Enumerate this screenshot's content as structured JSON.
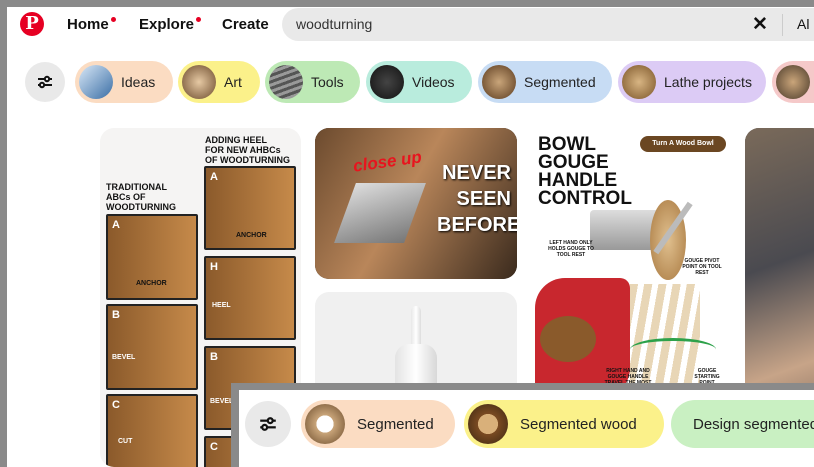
{
  "header": {
    "logo_letter": "P",
    "nav": [
      "Home",
      "Explore",
      "Create"
    ],
    "search_value": "woodturning",
    "clear_icon": "✕",
    "scope_label": "Al"
  },
  "chips": [
    {
      "label": "Ideas",
      "color": "#fbdcc2"
    },
    {
      "label": "Art",
      "color": "#fbf18a"
    },
    {
      "label": "Tools",
      "color": "#bde9b5"
    },
    {
      "label": "Videos",
      "color": "#b9ecdd"
    },
    {
      "label": "Segmented",
      "color": "#c7dcf4"
    },
    {
      "label": "Lathe projects",
      "color": "#dccbf5"
    }
  ],
  "pins": {
    "p1": {
      "title_right": [
        "ADDING HEEL",
        "FOR NEW AHBCs",
        "OF WOODTURNING"
      ],
      "title_left": [
        "TRADITIONAL",
        "ABCs OF",
        "WOODTURNING"
      ],
      "letters": [
        "A",
        "B",
        "C",
        "A",
        "H",
        "B",
        "C"
      ],
      "labels": [
        "ANCHOR",
        "BEVEL",
        "CUT",
        "ANCHOR",
        "HEEL",
        "BEVEL"
      ]
    },
    "p2": {
      "overlay_red": "close up",
      "lines": [
        "NEVER",
        "SEEN",
        "BEFORE"
      ]
    },
    "p4": {
      "title": [
        "BOWL",
        "GOUGE",
        "HANDLE",
        "CONTROL"
      ],
      "brand": "Turn A Wood Bowl",
      "notes": [
        "LEFT HAND ONLY HOLDS GOUGE TO TOOL REST",
        "GOUGE PIVOT POINT ON TOOL REST",
        "RIGHT HAND AND GOUGE HANDLE TRAVEL THE MOST",
        "GOUGE STARTING POINT"
      ]
    }
  },
  "overlay_chips": [
    {
      "label": "Segmented",
      "color": "#fbdcc2"
    },
    {
      "label": "Segmented wood",
      "color": "#fbf18a"
    },
    {
      "label": "Design segmented",
      "color": "#c9f0c2"
    }
  ]
}
